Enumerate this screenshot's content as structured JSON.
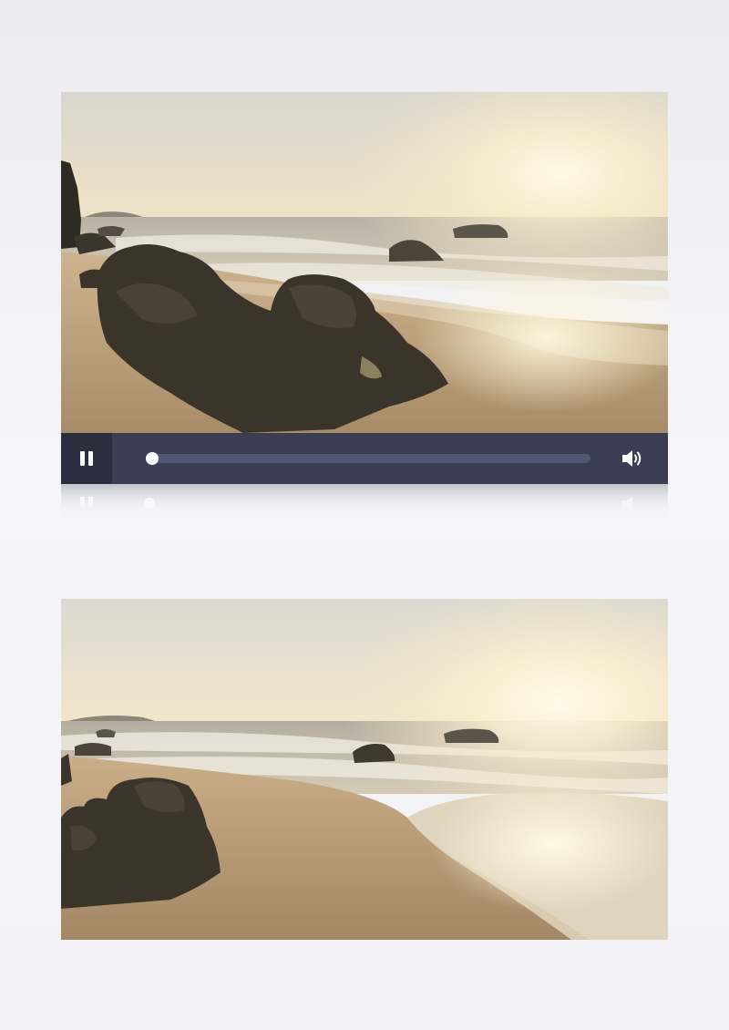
{
  "player": {
    "state": "playing",
    "progress": 0.005,
    "pause_icon": "pause-icon",
    "volume_icon": "volume-icon",
    "colors": {
      "bar_background": "#3a3e52",
      "button_background": "#2b2e3f",
      "track": "#525771",
      "knob": "#ffffff"
    }
  },
  "scenes": [
    {
      "subject": "beach-sunset-rocks"
    },
    {
      "subject": "beach-sunset-shoreline"
    }
  ]
}
